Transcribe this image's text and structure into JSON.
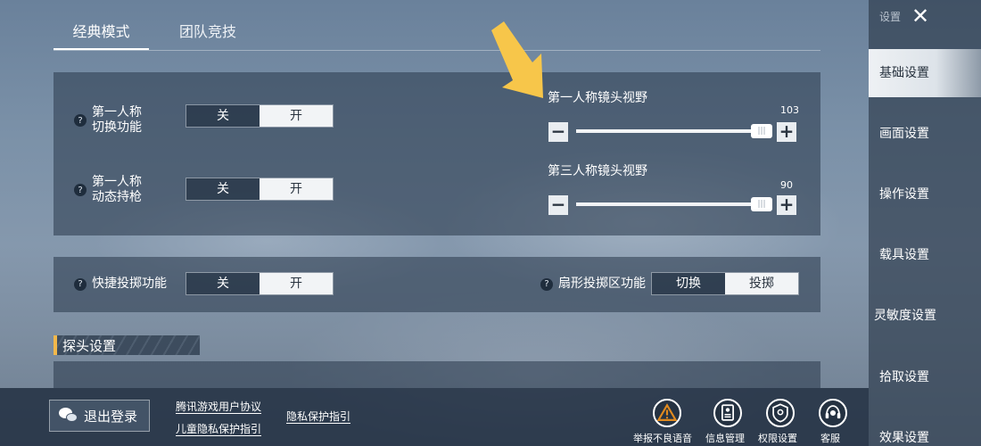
{
  "tabs": [
    {
      "label": "经典模式",
      "active": true
    },
    {
      "label": "团队竞技",
      "active": false
    }
  ],
  "first_person_switch": {
    "label": "第一人称\n切换功能",
    "off": "关",
    "on": "开",
    "selected": "开"
  },
  "first_person_dynamic_gun": {
    "label": "第一人称\n动态持枪",
    "off": "关",
    "on": "开",
    "selected": "开"
  },
  "fov_first_person": {
    "title": "第一人称镜头视野",
    "value": "103",
    "fraction": 1.0
  },
  "fov_third_person": {
    "title": "第三人称镜头视野",
    "value": "90",
    "fraction": 1.0
  },
  "quick_throw": {
    "label": "快捷投掷功能",
    "off": "关",
    "on": "开",
    "selected": "开"
  },
  "fan_throw_zone": {
    "label": "扇形投掷区功能",
    "option_a": "切换",
    "option_b": "投掷",
    "selected": "投掷"
  },
  "section_header": "探头设置",
  "sidebar": {
    "title": "设置",
    "items": [
      {
        "label": "基础设置",
        "active": true
      },
      {
        "label": "画面设置",
        "active": false
      },
      {
        "label": "操作设置",
        "active": false
      },
      {
        "label": "载具设置",
        "active": false
      },
      {
        "label": "灵敏度设置",
        "active": false
      },
      {
        "label": "拾取设置",
        "active": false
      },
      {
        "label": "效果设置",
        "active": false
      }
    ]
  },
  "bottom": {
    "logout_label": "退出登录",
    "link_user_agreement": "腾讯游戏用户协议",
    "link_child_privacy": "儿童隐私保护指引",
    "link_privacy": "隐私保护指引",
    "icons": [
      {
        "label": "举报不良语音",
        "icon": "warning-icon"
      },
      {
        "label": "信息管理",
        "icon": "document-icon"
      },
      {
        "label": "权限设置",
        "icon": "location-shield-icon"
      },
      {
        "label": "客服",
        "icon": "headset-icon"
      }
    ]
  },
  "colors": {
    "accent": "#f2b84b",
    "arrow": "#f7c64a",
    "warning": "#e08a1f",
    "active_toggle": "#f2f4f6"
  }
}
